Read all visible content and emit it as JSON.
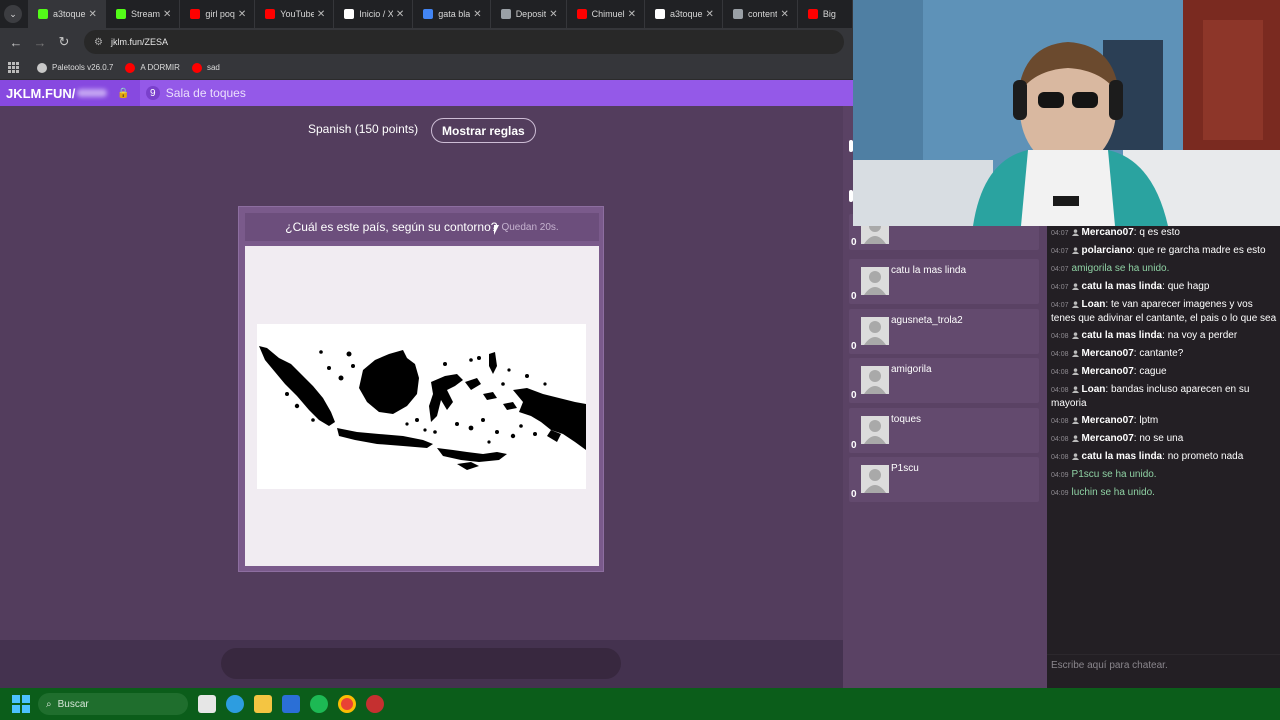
{
  "browser": {
    "tabs": [
      {
        "title": "a3toque",
        "icon": "kick-icon",
        "color": "#53fc18"
      },
      {
        "title": "Stream",
        "icon": "kick-icon",
        "color": "#53fc18"
      },
      {
        "title": "girl poq",
        "icon": "youtube-icon",
        "color": "#ff0000"
      },
      {
        "title": "YouTube",
        "icon": "youtube-icon",
        "color": "#ff0000"
      },
      {
        "title": "Inicio / X",
        "icon": "x-icon",
        "color": "#ffffff"
      },
      {
        "title": "gata bla",
        "icon": "google-icon",
        "color": "#4285f4"
      },
      {
        "title": "Deposit",
        "icon": "globe-icon",
        "color": "#9aa0a6"
      },
      {
        "title": "Chimuel",
        "icon": "youtube-icon",
        "color": "#ff0000"
      },
      {
        "title": "a3toque",
        "icon": "tiktok-icon",
        "color": "#ffffff"
      },
      {
        "title": "content",
        "icon": "globe-icon",
        "color": "#9aa0a6"
      },
      {
        "title": "Big",
        "icon": "youtube-icon",
        "color": "#ff0000"
      }
    ],
    "url": "jklm.fun/ZESA",
    "bookmarks": [
      {
        "label": "Paletools v26.0.7",
        "icon": "globe-icon",
        "color": "#c8c8c8"
      },
      {
        "label": "A DORMIR",
        "icon": "youtube-icon",
        "color": "#ff0000"
      },
      {
        "label": "sad",
        "icon": "youtube-icon",
        "color": "#ff0000"
      }
    ]
  },
  "site": {
    "logo": "JKLM.FUN/",
    "room_count": "9",
    "room_name": "Sala de toques"
  },
  "game": {
    "mode": "Spanish (150 points)",
    "rules_button": "Mostrar reglas",
    "question": "¿Cuál es este país, según su contorno?",
    "timer": "Quedan 20s."
  },
  "players": [
    {
      "name": "catu la mas linda",
      "score": "0"
    },
    {
      "name": "agusneta_trola2",
      "score": "0"
    },
    {
      "name": "amigorila",
      "score": "0"
    },
    {
      "name": "toques",
      "score": "0"
    },
    {
      "name": "P1scu",
      "score": "0"
    }
  ],
  "partial_player_score": "0",
  "chat": {
    "messages": [
      {
        "time": "04:07",
        "user": "Mercano07",
        "text": "q es esto"
      },
      {
        "time": "04:07",
        "user": "polarciano",
        "text": "que re garcha madre es esto"
      },
      {
        "time": "04:07",
        "system": "amigorila se ha unido."
      },
      {
        "time": "04:07",
        "user": "catu la mas linda",
        "text": "que hagp"
      },
      {
        "time": "04:07",
        "user": "Loan",
        "text": "te van aparecer imagenes y vos tenes que adivinar el cantante, el pais o lo que sea"
      },
      {
        "time": "04:08",
        "user": "catu la mas linda",
        "text": "na voy a perder"
      },
      {
        "time": "04:08",
        "user": "Mercano07",
        "text": "cantante?"
      },
      {
        "time": "04:08",
        "user": "Mercano07",
        "text": "cague"
      },
      {
        "time": "04:08",
        "user": "Loan",
        "text": "bandas incluso aparecen en su mayoria"
      },
      {
        "time": "04:08",
        "user": "Mercano07",
        "text": "lptm"
      },
      {
        "time": "04:08",
        "user": "Mercano07",
        "text": "no se una"
      },
      {
        "time": "04:08",
        "user": "catu la mas linda",
        "text": "no prometo nada"
      },
      {
        "time": "04:09",
        "system": "P1scu se ha unido."
      },
      {
        "time": "04:09",
        "system": "luchin se ha unido."
      }
    ],
    "input_placeholder": "Escribe aquí para chatear."
  },
  "taskbar": {
    "search_placeholder": "Buscar"
  }
}
